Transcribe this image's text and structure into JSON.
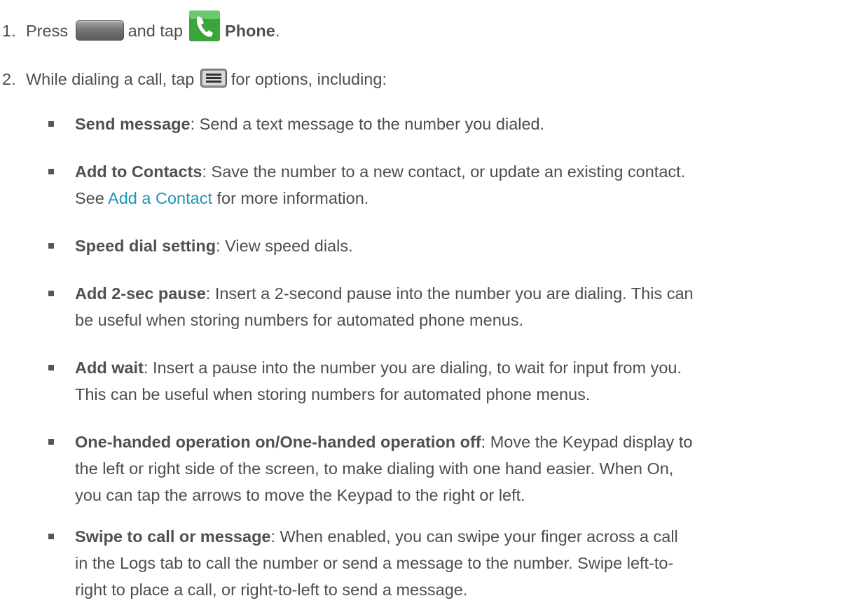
{
  "step1": {
    "number": "1.",
    "text_before": "Press",
    "text_middle": "and tap",
    "app_name": "Phone",
    "text_after": "."
  },
  "step2": {
    "number": "2.",
    "text_before": "While dialing a call, tap",
    "text_after": "for options, including:"
  },
  "options": [
    {
      "title": "Send message",
      "line1": ": Send a text message to the number you dialed."
    },
    {
      "title": "Add to Contacts",
      "line1": ": Save the number to a new contact, or update an existing contact.",
      "line2_before": "See ",
      "link": "Add a Contact",
      "line2_after": " for more information."
    },
    {
      "title": "Speed dial setting",
      "line1": ": View speed dials."
    },
    {
      "title": "Add 2-sec pause",
      "line1": ": Insert a 2-second pause into the number you are dialing. This can",
      "line2": "be useful when storing numbers for automated phone menus."
    },
    {
      "title": "Add wait",
      "line1": ": Insert a pause into the number you are dialing, to wait for input from you.",
      "line2": "This can be useful when storing numbers for automated phone menus."
    },
    {
      "title": "One-handed operation on/One-handed operation off",
      "line1": ": Move the Keypad display to",
      "line2": "the left or right side of the screen, to make dialing with one hand easier. When On,",
      "line3": "you can tap the arrows to move the Keypad to the right or left."
    },
    {
      "title": "Swipe to call or message",
      "line1": ": When enabled, you can swipe your finger across a call",
      "line2": "in the Logs tab to call the number or send a message to the number. Swipe left-to-",
      "line3": "right to place a call, or right-to-left to send a message."
    }
  ],
  "colors": {
    "text": "#4d4d4d",
    "link": "#1a96b8",
    "phone_icon": "#3aa53a"
  }
}
